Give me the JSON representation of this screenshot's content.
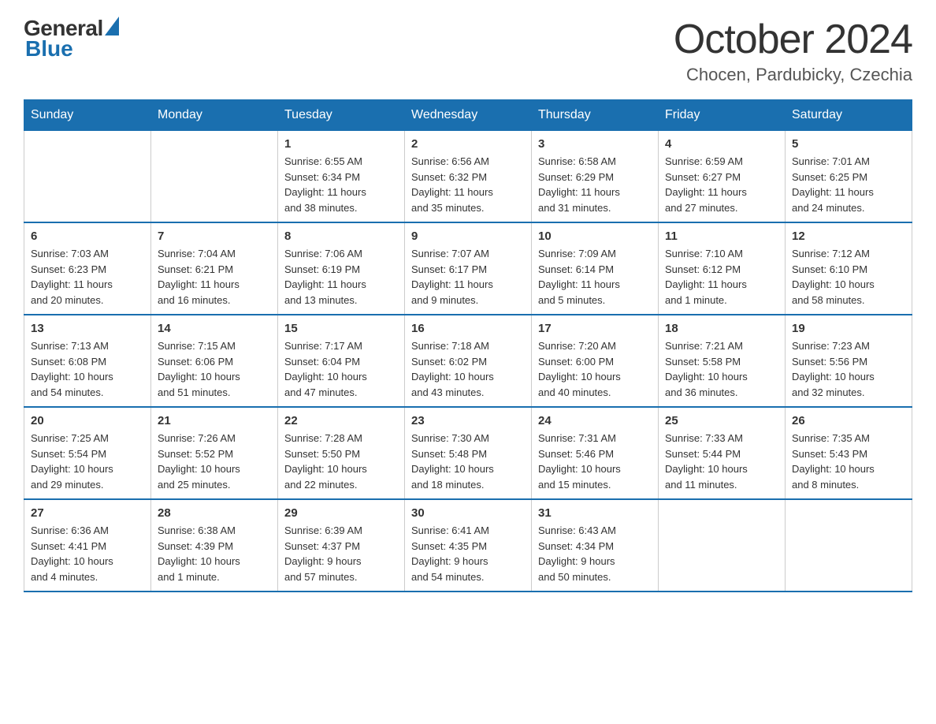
{
  "header": {
    "title": "October 2024",
    "subtitle": "Chocen, Pardubicky, Czechia",
    "logo_general": "General",
    "logo_blue": "Blue"
  },
  "calendar": {
    "days_of_week": [
      "Sunday",
      "Monday",
      "Tuesday",
      "Wednesday",
      "Thursday",
      "Friday",
      "Saturday"
    ],
    "weeks": [
      [
        {
          "day": "",
          "info": ""
        },
        {
          "day": "",
          "info": ""
        },
        {
          "day": "1",
          "info": "Sunrise: 6:55 AM\nSunset: 6:34 PM\nDaylight: 11 hours\nand 38 minutes."
        },
        {
          "day": "2",
          "info": "Sunrise: 6:56 AM\nSunset: 6:32 PM\nDaylight: 11 hours\nand 35 minutes."
        },
        {
          "day": "3",
          "info": "Sunrise: 6:58 AM\nSunset: 6:29 PM\nDaylight: 11 hours\nand 31 minutes."
        },
        {
          "day": "4",
          "info": "Sunrise: 6:59 AM\nSunset: 6:27 PM\nDaylight: 11 hours\nand 27 minutes."
        },
        {
          "day": "5",
          "info": "Sunrise: 7:01 AM\nSunset: 6:25 PM\nDaylight: 11 hours\nand 24 minutes."
        }
      ],
      [
        {
          "day": "6",
          "info": "Sunrise: 7:03 AM\nSunset: 6:23 PM\nDaylight: 11 hours\nand 20 minutes."
        },
        {
          "day": "7",
          "info": "Sunrise: 7:04 AM\nSunset: 6:21 PM\nDaylight: 11 hours\nand 16 minutes."
        },
        {
          "day": "8",
          "info": "Sunrise: 7:06 AM\nSunset: 6:19 PM\nDaylight: 11 hours\nand 13 minutes."
        },
        {
          "day": "9",
          "info": "Sunrise: 7:07 AM\nSunset: 6:17 PM\nDaylight: 11 hours\nand 9 minutes."
        },
        {
          "day": "10",
          "info": "Sunrise: 7:09 AM\nSunset: 6:14 PM\nDaylight: 11 hours\nand 5 minutes."
        },
        {
          "day": "11",
          "info": "Sunrise: 7:10 AM\nSunset: 6:12 PM\nDaylight: 11 hours\nand 1 minute."
        },
        {
          "day": "12",
          "info": "Sunrise: 7:12 AM\nSunset: 6:10 PM\nDaylight: 10 hours\nand 58 minutes."
        }
      ],
      [
        {
          "day": "13",
          "info": "Sunrise: 7:13 AM\nSunset: 6:08 PM\nDaylight: 10 hours\nand 54 minutes."
        },
        {
          "day": "14",
          "info": "Sunrise: 7:15 AM\nSunset: 6:06 PM\nDaylight: 10 hours\nand 51 minutes."
        },
        {
          "day": "15",
          "info": "Sunrise: 7:17 AM\nSunset: 6:04 PM\nDaylight: 10 hours\nand 47 minutes."
        },
        {
          "day": "16",
          "info": "Sunrise: 7:18 AM\nSunset: 6:02 PM\nDaylight: 10 hours\nand 43 minutes."
        },
        {
          "day": "17",
          "info": "Sunrise: 7:20 AM\nSunset: 6:00 PM\nDaylight: 10 hours\nand 40 minutes."
        },
        {
          "day": "18",
          "info": "Sunrise: 7:21 AM\nSunset: 5:58 PM\nDaylight: 10 hours\nand 36 minutes."
        },
        {
          "day": "19",
          "info": "Sunrise: 7:23 AM\nSunset: 5:56 PM\nDaylight: 10 hours\nand 32 minutes."
        }
      ],
      [
        {
          "day": "20",
          "info": "Sunrise: 7:25 AM\nSunset: 5:54 PM\nDaylight: 10 hours\nand 29 minutes."
        },
        {
          "day": "21",
          "info": "Sunrise: 7:26 AM\nSunset: 5:52 PM\nDaylight: 10 hours\nand 25 minutes."
        },
        {
          "day": "22",
          "info": "Sunrise: 7:28 AM\nSunset: 5:50 PM\nDaylight: 10 hours\nand 22 minutes."
        },
        {
          "day": "23",
          "info": "Sunrise: 7:30 AM\nSunset: 5:48 PM\nDaylight: 10 hours\nand 18 minutes."
        },
        {
          "day": "24",
          "info": "Sunrise: 7:31 AM\nSunset: 5:46 PM\nDaylight: 10 hours\nand 15 minutes."
        },
        {
          "day": "25",
          "info": "Sunrise: 7:33 AM\nSunset: 5:44 PM\nDaylight: 10 hours\nand 11 minutes."
        },
        {
          "day": "26",
          "info": "Sunrise: 7:35 AM\nSunset: 5:43 PM\nDaylight: 10 hours\nand 8 minutes."
        }
      ],
      [
        {
          "day": "27",
          "info": "Sunrise: 6:36 AM\nSunset: 4:41 PM\nDaylight: 10 hours\nand 4 minutes."
        },
        {
          "day": "28",
          "info": "Sunrise: 6:38 AM\nSunset: 4:39 PM\nDaylight: 10 hours\nand 1 minute."
        },
        {
          "day": "29",
          "info": "Sunrise: 6:39 AM\nSunset: 4:37 PM\nDaylight: 9 hours\nand 57 minutes."
        },
        {
          "day": "30",
          "info": "Sunrise: 6:41 AM\nSunset: 4:35 PM\nDaylight: 9 hours\nand 54 minutes."
        },
        {
          "day": "31",
          "info": "Sunrise: 6:43 AM\nSunset: 4:34 PM\nDaylight: 9 hours\nand 50 minutes."
        },
        {
          "day": "",
          "info": ""
        },
        {
          "day": "",
          "info": ""
        }
      ]
    ]
  }
}
